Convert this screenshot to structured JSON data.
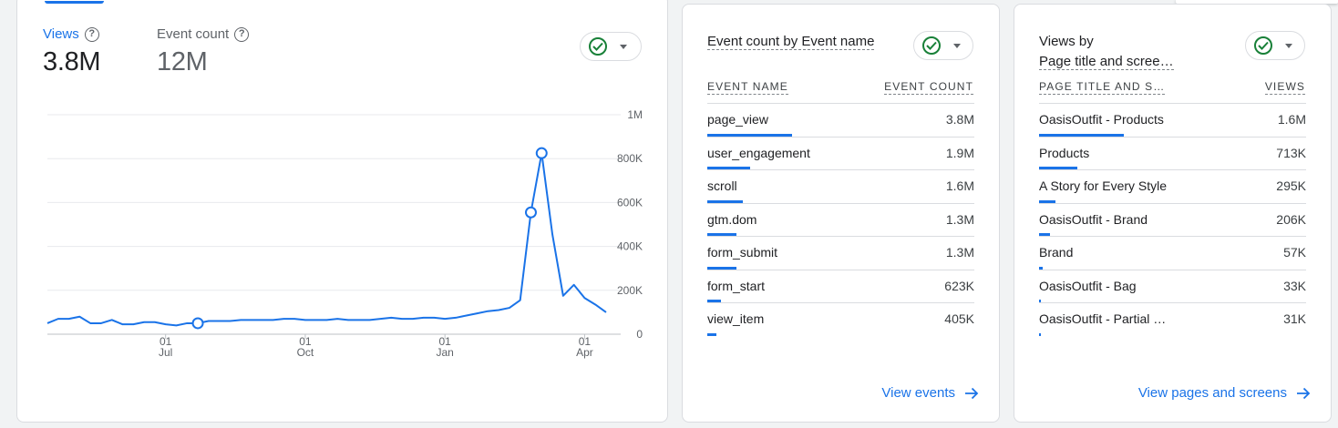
{
  "main_card": {
    "metrics": [
      {
        "label": "Views",
        "value": "3.8M"
      },
      {
        "label": "Event count",
        "value": "12M"
      }
    ]
  },
  "chart_data": {
    "type": "line",
    "series": [
      {
        "name": "Views",
        "values": [
          50000,
          70000,
          70000,
          80000,
          50000,
          50000,
          65000,
          45000,
          45000,
          55000,
          55000,
          45000,
          40000,
          50000,
          50000,
          60000,
          60000,
          60000,
          65000,
          65000,
          65000,
          65000,
          70000,
          70000,
          65000,
          65000,
          65000,
          70000,
          65000,
          65000,
          65000,
          70000,
          75000,
          70000,
          70000,
          75000,
          75000,
          70000,
          75000,
          85000,
          95000,
          105000,
          110000,
          120000,
          155000,
          555000,
          825000,
          455000,
          175000,
          225000,
          165000,
          135000,
          100000
        ]
      }
    ],
    "markers": [
      14,
      45,
      46
    ],
    "x_ticks": [
      {
        "day": "01",
        "month": "Jul",
        "index": 11
      },
      {
        "day": "01",
        "month": "Oct",
        "index": 24
      },
      {
        "day": "01",
        "month": "Jan",
        "index": 37
      },
      {
        "day": "01",
        "month": "Apr",
        "index": 50
      }
    ],
    "y_ticks": [
      "0",
      "200K",
      "400K",
      "600K",
      "800K",
      "1M"
    ],
    "ylim": [
      0,
      1000000
    ],
    "color": "#1a73e8",
    "grid": true
  },
  "events_card": {
    "title": "Event count by Event name",
    "col_name": "EVENT NAME",
    "col_value": "EVENT COUNT",
    "rows": [
      {
        "name": "page_view",
        "value": "3.8M",
        "fraction": 1.0
      },
      {
        "name": "user_engagement",
        "value": "1.9M",
        "fraction": 0.5
      },
      {
        "name": "scroll",
        "value": "1.6M",
        "fraction": 0.42
      },
      {
        "name": "gtm.dom",
        "value": "1.3M",
        "fraction": 0.34
      },
      {
        "name": "form_submit",
        "value": "1.3M",
        "fraction": 0.34
      },
      {
        "name": "form_start",
        "value": "623K",
        "fraction": 0.16
      },
      {
        "name": "view_item",
        "value": "405K",
        "fraction": 0.11
      }
    ],
    "link": "View events"
  },
  "pages_card": {
    "title_line1": "Views by",
    "title_line2": "Page title and scree…",
    "col_name": "PAGE TITLE AND S…",
    "col_value": "VIEWS",
    "rows": [
      {
        "name": "OasisOutfit - Products",
        "value": "1.6M",
        "fraction": 1.0
      },
      {
        "name": "Products",
        "value": "713K",
        "fraction": 0.45
      },
      {
        "name": "A Story for Every Style",
        "value": "295K",
        "fraction": 0.19
      },
      {
        "name": "OasisOutfit - Brand",
        "value": "206K",
        "fraction": 0.13
      },
      {
        "name": "Brand",
        "value": "57K",
        "fraction": 0.04
      },
      {
        "name": "OasisOutfit - Bag",
        "value": "33K",
        "fraction": 0.025
      },
      {
        "name": "OasisOutfit - Partial …",
        "value": "31K",
        "fraction": 0.02
      }
    ],
    "link": "View pages and screens"
  },
  "icons": {
    "help": "help-circle-icon",
    "check": "check-circle-icon",
    "dropdown": "chevron-down-icon",
    "arrow": "arrow-right-icon"
  },
  "colors": {
    "accent": "#1a73e8",
    "check": "#188038"
  }
}
